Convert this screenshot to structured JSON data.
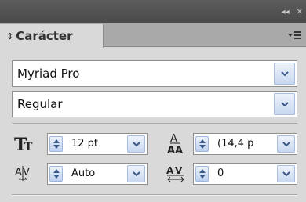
{
  "window": {
    "collapse_icon": "double-chevron-right-icon",
    "close_icon": "close-icon",
    "collapse_glyph": "◂◂",
    "close_glyph": "✕"
  },
  "panel": {
    "tab_title": "Carácter",
    "tab_arrows": "⇕",
    "menu_icon": "panel-menu-icon"
  },
  "font_family": {
    "value": "Myriad Pro"
  },
  "font_style": {
    "value": "Regular"
  },
  "font_size": {
    "value": "12 pt",
    "icon": "font-size-icon"
  },
  "leading": {
    "value": "(14,4 p",
    "icon": "leading-icon"
  },
  "kerning": {
    "value": "Auto",
    "icon": "kerning-icon"
  },
  "tracking": {
    "value": "0",
    "icon": "tracking-icon"
  },
  "colors": {
    "accent_button": "#c9d8f0",
    "chevron": "#3c5a8a"
  }
}
